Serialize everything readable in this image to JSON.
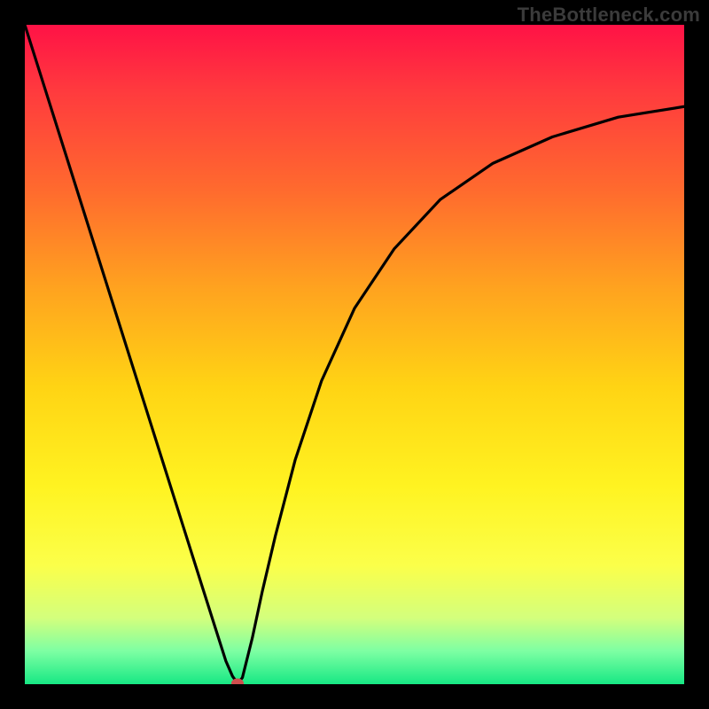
{
  "watermark": "TheBottleneck.com",
  "chart_data": {
    "type": "line",
    "title": "",
    "xlabel": "",
    "ylabel": "",
    "xlim": [
      0,
      1
    ],
    "ylim": [
      0,
      1
    ],
    "grid": false,
    "legend": false,
    "series": [
      {
        "name": "bottleneck-curve",
        "x": [
          0.0,
          0.03,
          0.06,
          0.09,
          0.12,
          0.15,
          0.18,
          0.21,
          0.24,
          0.27,
          0.29,
          0.305,
          0.315,
          0.323,
          0.33,
          0.345,
          0.36,
          0.38,
          0.41,
          0.45,
          0.5,
          0.56,
          0.63,
          0.71,
          0.8,
          0.9,
          1.0
        ],
        "y": [
          1.0,
          0.905,
          0.81,
          0.715,
          0.62,
          0.525,
          0.43,
          0.335,
          0.24,
          0.145,
          0.082,
          0.035,
          0.012,
          0.001,
          0.01,
          0.07,
          0.14,
          0.225,
          0.34,
          0.46,
          0.57,
          0.66,
          0.735,
          0.79,
          0.83,
          0.86,
          0.876
        ]
      }
    ],
    "marker": {
      "x": 0.323,
      "y": 0.001,
      "color": "#cf4e4e"
    },
    "gradient_stops": [
      {
        "offset": 0.0,
        "color": "#ff1246"
      },
      {
        "offset": 0.1,
        "color": "#ff3a3e"
      },
      {
        "offset": 0.25,
        "color": "#ff6a2e"
      },
      {
        "offset": 0.4,
        "color": "#ffa31f"
      },
      {
        "offset": 0.55,
        "color": "#ffd414"
      },
      {
        "offset": 0.7,
        "color": "#fff321"
      },
      {
        "offset": 0.82,
        "color": "#fbff4a"
      },
      {
        "offset": 0.9,
        "color": "#d3ff7d"
      },
      {
        "offset": 0.95,
        "color": "#7dffa3"
      },
      {
        "offset": 1.0,
        "color": "#17e884"
      }
    ]
  }
}
